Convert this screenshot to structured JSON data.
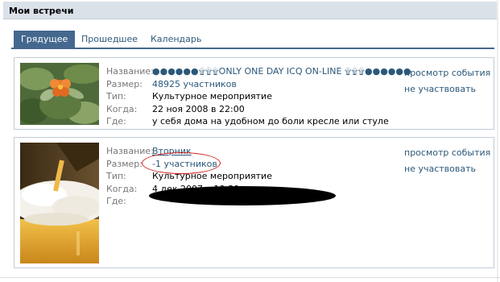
{
  "header": {
    "title": "Мои встречи"
  },
  "tabs": [
    {
      "label": "Грядущее",
      "active": true
    },
    {
      "label": "Прошедшее",
      "active": false
    },
    {
      "label": "Календарь",
      "active": false
    }
  ],
  "labels": {
    "name": "Название:",
    "size": "Размер:",
    "type": "Тип:",
    "when": "Когда:",
    "where": "Где:"
  },
  "events": [
    {
      "name": "●●●●●●۩۩۩ONLY ONE DAY ICQ ON-LINE ۩۩۩●●●●●●",
      "size": "48925 участников",
      "type": "Культурное мероприятие",
      "when": "22 ноя 2008 в 22:00",
      "where": "у себя дома на удобном до боли кресле или стуле",
      "actions": [
        "просмотр события",
        "не участвовать"
      ],
      "image": "flower-photo"
    },
    {
      "name": "Вторник",
      "size": "-1 участников",
      "type": "Культурное мероприятие",
      "when": "4 дек 2007 в 19:30",
      "where": "",
      "actions": [
        "просмотр события",
        "не участвовать"
      ],
      "image": "beer-photo"
    }
  ],
  "colors": {
    "accent": "#45688e",
    "link": "#2b587a",
    "annotation": "#d21e1e"
  }
}
